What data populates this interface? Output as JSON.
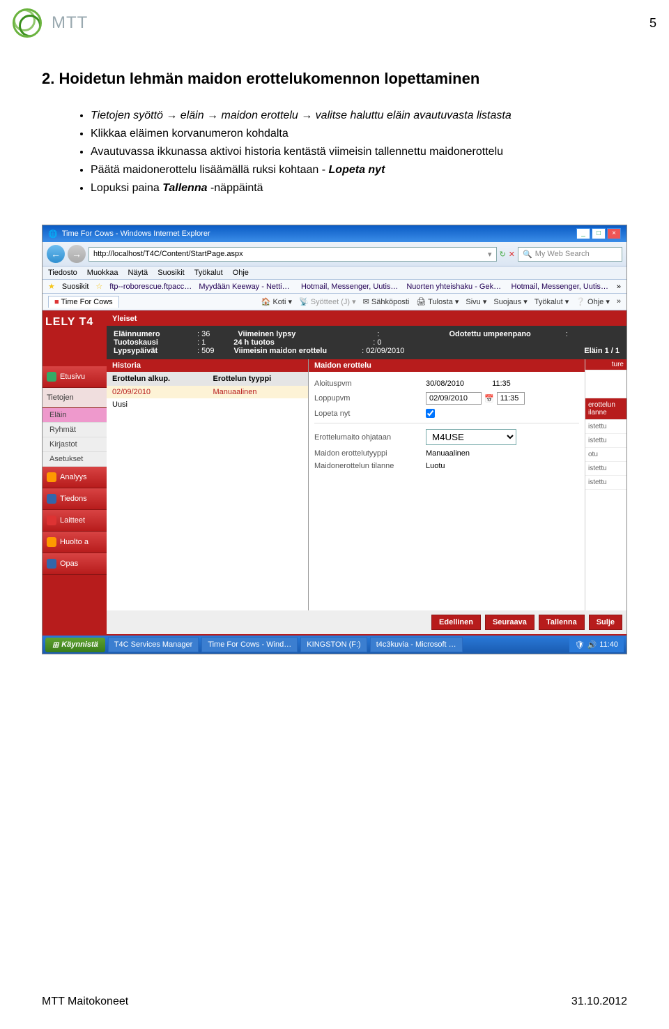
{
  "page": {
    "number": "5",
    "brand": "MTT",
    "section_title": "2. Hoidetun lehmän maidon erottelukomennon lopettaminen",
    "bullets": [
      {
        "text": "Tietojen syöttö → eläin → maidon erottelu → valitse haluttu eläin avautuvasta listasta",
        "italic": true
      },
      {
        "text": "Klikkaa eläimen korvanumeron kohdalta",
        "italic": false
      },
      {
        "text": "Avautuvassa ikkunassa aktivoi historia kentästä viimeisin tallennettu maidonerottelu",
        "italic": false
      },
      {
        "text": "Päätä maidonerottelu lisäämällä ruksi kohtaan - Lopeta nyt",
        "italic": false,
        "bold_part": "Lopeta nyt"
      },
      {
        "text": "Lopuksi paina Tallenna -näppäintä",
        "italic": false,
        "bold_part": "Tallenna"
      }
    ],
    "footer_left": "MTT Maitokoneet",
    "footer_right": "31.10.2012"
  },
  "browser": {
    "title": "Time For Cows - Windows Internet Explorer",
    "address": "http://localhost/T4C/Content/StartPage.aspx",
    "search_placeholder": "My Web Search",
    "menu": [
      "Tiedosto",
      "Muokkaa",
      "Näytä",
      "Suosikit",
      "Työkalut",
      "Ohje"
    ],
    "fav_label": "Suosikit",
    "fav_links": [
      "ftp--roborescue.ftpaccess",
      "Myydään Keeway - Nettimoto",
      "Hotmail, Messenger, Uutiset…",
      "Nuorten yhteishaku - Gekko…",
      "Hotmail, Messenger, Uutiset…"
    ],
    "tab_title": "Time For Cows",
    "cmd_items": [
      "Koti",
      "Syötteet (J)",
      "Sähköposti",
      "Tulosta",
      "Sivu",
      "Suojaus",
      "Työkalut",
      "Ohje"
    ]
  },
  "app": {
    "brand": "LELY T4",
    "left_nav": [
      "Etusivu",
      "Tietojen"
    ],
    "sub_nav": [
      "Eläin",
      "Ryhmät",
      "Kirjastot",
      "Asetukset"
    ],
    "left_nav2": [
      "Analyys",
      "Tiedons",
      "Laitteet",
      "Huolto a",
      "Opas"
    ],
    "hdr1": "Yleiset",
    "info": {
      "elainnumero_lbl": "Eläinnumero",
      "elainnumero": "36",
      "tuotoskausi_lbl": "Tuotoskausi",
      "tuotoskausi": "1",
      "lypsypaivat_lbl": "Lypsypäivät",
      "lypsypaivat": "509",
      "viimeinen_lypsy_lbl": "Viimeinen lypsy",
      "viimeinen_lypsy": ":",
      "tuotos24h_lbl": "24 h tuotos",
      "tuotos24h": "0",
      "viimeisin_me_lbl": "Viimeisin maidon erottelu",
      "viimeisin_me": "02/09/2010",
      "odotettu_lbl": "Odotettu umpeenpano",
      "odotettu": ":",
      "elain_count": "Eläin 1 / 1"
    },
    "historia_hdr": "Historia",
    "historia_cols": [
      "Erottelun alkup.",
      "Erottelun tyyppi"
    ],
    "historia_rows": [
      {
        "date": "02/09/2010",
        "type": "Manuaalinen",
        "sel": true
      },
      {
        "date": "Uusi",
        "type": "",
        "sel": false
      }
    ],
    "me_hdr": "Maidon erottelu",
    "form": {
      "aloituspvm_lbl": "Aloituspvm",
      "aloituspvm_date": "30/08/2010",
      "aloituspvm_time": "11:35",
      "loppupvm_lbl": "Loppupvm",
      "loppupvm_date": "02/09/2010",
      "loppupvm_time": "11:35",
      "lopeta_nyt_lbl": "Lopeta nyt",
      "erottelu_ohjataan_lbl": "Erottelumaito ohjataan",
      "erottelu_ohjataan": "M4USE",
      "tyyppi_lbl": "Maidon erottelutyyppi",
      "tyyppi": "Manuaalinen",
      "tilanne_lbl": "Maidonerottelun tilanne",
      "tilanne": "Luotu"
    },
    "right_hdr": "erottelun ilanne",
    "right_items": [
      "istettu",
      "istettu",
      "otu",
      "istettu",
      "istettu"
    ],
    "buttons": [
      "Edellinen",
      "Seuraava",
      "Tallenna",
      "Sulje"
    ],
    "culture": "ture"
  },
  "taskbar": {
    "start": "Käynnistä",
    "items": [
      "T4C Services Manager",
      "Time For Cows - Wind…",
      "KINGSTON (F:)",
      "t4c3kuvia - Microsoft …"
    ],
    "clock": "11:40"
  }
}
